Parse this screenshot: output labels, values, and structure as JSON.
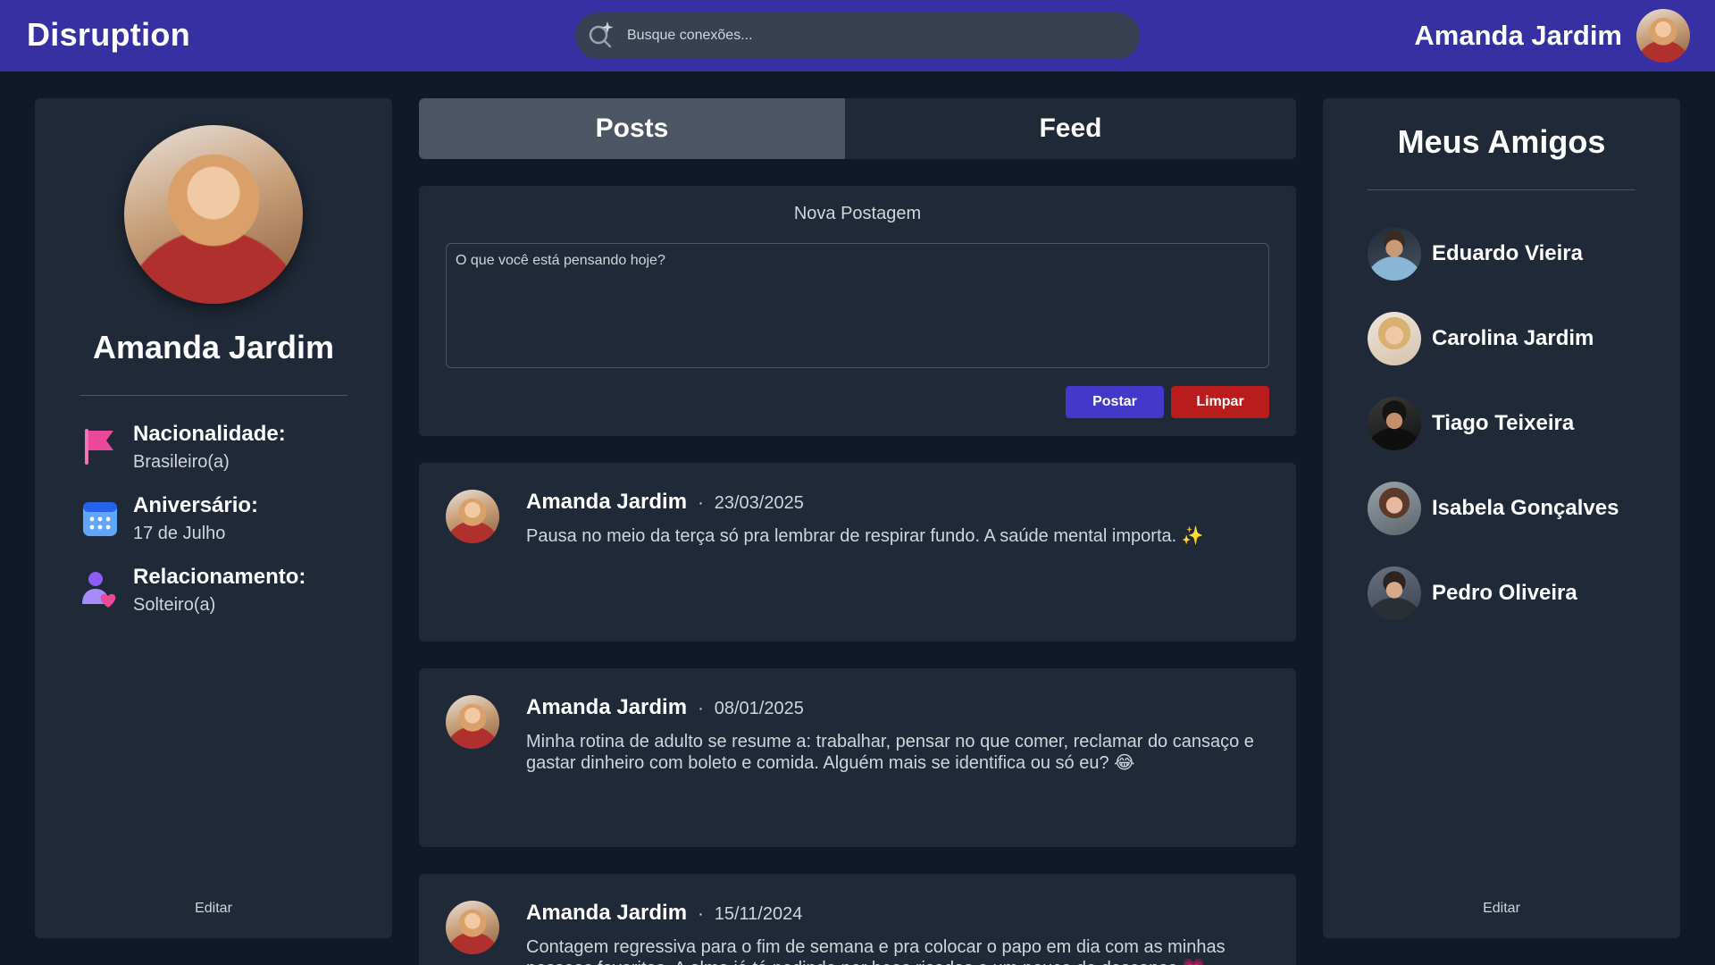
{
  "app": {
    "brand": "Disruption"
  },
  "search": {
    "placeholder": "Busque conexões..."
  },
  "header_user": {
    "name": "Amanda Jardim"
  },
  "profile": {
    "name": "Amanda Jardim",
    "info": [
      {
        "icon": "flag-icon",
        "label": "Nacionalidade:",
        "value": "Brasileiro(a)"
      },
      {
        "icon": "calendar-icon",
        "label": "Aniversário:",
        "value": "17 de Julho"
      },
      {
        "icon": "relationship-icon",
        "label": "Relacionamento:",
        "value": "Solteiro(a)"
      }
    ],
    "edit_label": "Editar"
  },
  "tabs": [
    {
      "label": "Posts",
      "active": true
    },
    {
      "label": "Feed",
      "active": false
    }
  ],
  "composer": {
    "title": "Nova Postagem",
    "placeholder": "O que você está pensando hoje?",
    "post_label": "Postar",
    "clear_label": "Limpar"
  },
  "posts": [
    {
      "author": "Amanda Jardim",
      "separator": "·",
      "date": "23/03/2025",
      "text": "Pausa no meio da terça só pra lembrar de respirar fundo. A saúde mental importa. ✨"
    },
    {
      "author": "Amanda Jardim",
      "separator": "·",
      "date": "08/01/2025",
      "text": "Minha rotina de adulto se resume a: trabalhar, pensar no que comer, reclamar do cansaço e gastar dinheiro com boleto e comida. Alguém mais se identifica ou só eu? 😂"
    },
    {
      "author": "Amanda Jardim",
      "separator": "·",
      "date": "15/11/2024",
      "text": "Contagem regressiva para o fim de semana e pra colocar o papo em dia com as minhas pessoas favoritas. A alma já tá pedindo por boas risadas e um pouco de descanso 💗"
    }
  ],
  "friends": {
    "title": "Meus Amigos",
    "list": [
      {
        "name": "Eduardo Vieira"
      },
      {
        "name": "Carolina Jardim"
      },
      {
        "name": "Tiago Teixeira"
      },
      {
        "name": "Isabela Gonçalves"
      },
      {
        "name": "Pedro Oliveira"
      }
    ],
    "edit_label": "Editar"
  },
  "colors": {
    "topbar": "#3730a3",
    "background": "#111827",
    "panel": "#1f2937",
    "active_tab": "#4b5563",
    "post_button": "#4338ca",
    "clear_button": "#b91c1c"
  }
}
